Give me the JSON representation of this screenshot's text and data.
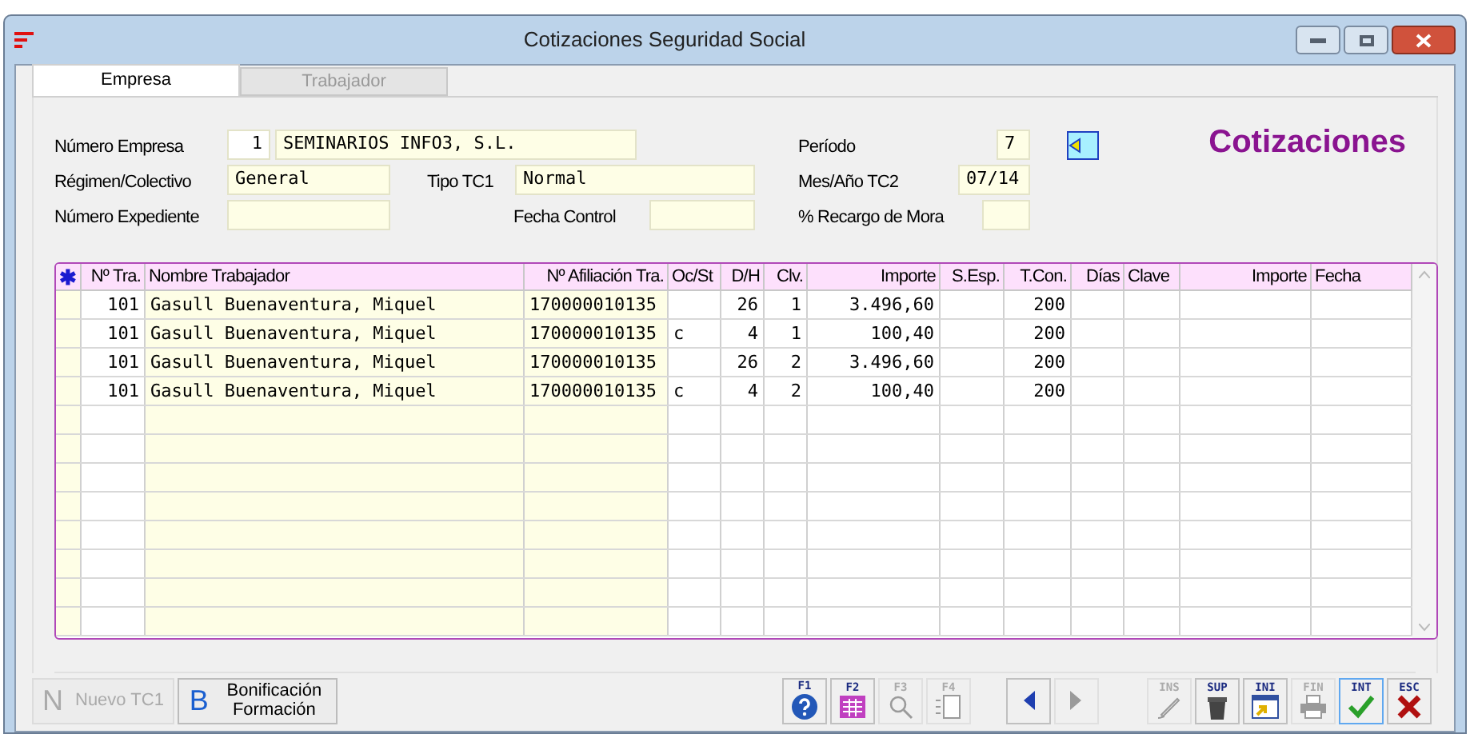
{
  "window": {
    "title": "Cotizaciones Seguridad Social"
  },
  "tabs": [
    {
      "label": "Empresa",
      "selected": true
    },
    {
      "label": "Trabajador",
      "selected": false
    }
  ],
  "form": {
    "numero_empresa": {
      "label": "Número Empresa",
      "code": "1",
      "name": "SEMINARIOS INFO3, S.L."
    },
    "regimen": {
      "label": "Régimen/Colectivo",
      "value": "General"
    },
    "tipo_tc1": {
      "label": "Tipo TC1",
      "value": "Normal"
    },
    "numero_expediente": {
      "label": "Número Expediente"
    },
    "fecha_control": {
      "label": "Fecha Control"
    },
    "periodo": {
      "label": "Período",
      "value": "7"
    },
    "mes_ano_tc2": {
      "label": "Mes/Año TC2",
      "value": "07/14"
    },
    "recargo_mora": {
      "label": "% Recargo de Mora"
    },
    "heading": "Cotizaciones"
  },
  "table": {
    "marker": "✱",
    "columns": [
      "Nº Tra.",
      "Nombre Trabajador",
      "Nº Afiliación Tra.",
      "Oc/St",
      "D/H",
      "Clv.",
      "Importe",
      "S.Esp.",
      "T.Con.",
      "Días",
      "Clave",
      "Importe",
      "Fecha"
    ],
    "rows": [
      {
        "n_tra": "101",
        "nombre": "Gasull Buenaventura, Miquel",
        "afiliacion": "170000010135",
        "d_h": "26",
        "clv": "1",
        "importe": "3.496,60",
        "t_con": "200"
      },
      {
        "n_tra": "101",
        "nombre": "Gasull Buenaventura, Miquel",
        "afiliacion": "170000010135",
        "oc_st": "c",
        "d_h": "4",
        "clv": "1",
        "importe": "100,40",
        "t_con": "200"
      },
      {
        "n_tra": "101",
        "nombre": "Gasull Buenaventura, Miquel",
        "afiliacion": "170000010135",
        "d_h": "26",
        "clv": "2",
        "importe": "3.496,60",
        "t_con": "200"
      },
      {
        "n_tra": "101",
        "nombre": "Gasull Buenaventura, Miquel",
        "afiliacion": "170000010135",
        "oc_st": "c",
        "d_h": "4",
        "clv": "2",
        "importe": "100,40",
        "t_con": "200"
      }
    ]
  },
  "actions": [
    {
      "letter": "N",
      "label": "Nuevo TC1",
      "disabled": true
    },
    {
      "letter": "B",
      "label": "Bonificación Formación",
      "disabled": false
    }
  ],
  "toolbar": [
    {
      "key": "F1",
      "kind": "help",
      "disabled": false
    },
    {
      "key": "F2",
      "kind": "table",
      "disabled": false
    },
    {
      "key": "F3",
      "kind": "search",
      "disabled": true
    },
    {
      "key": "F4",
      "kind": "list",
      "disabled": true
    },
    {
      "kind": "prev",
      "disabled": false
    },
    {
      "kind": "next",
      "disabled": true
    },
    {
      "key": "INS",
      "kind": "pencil",
      "disabled": true
    },
    {
      "key": "SUP",
      "kind": "trash",
      "disabled": false
    },
    {
      "key": "INI",
      "kind": "first",
      "disabled": false
    },
    {
      "key": "FIN",
      "kind": "printer",
      "disabled": true
    },
    {
      "key": "INT",
      "kind": "check",
      "disabled": false,
      "selected": true
    },
    {
      "key": "ESC",
      "kind": "close",
      "disabled": false,
      "selected": false
    }
  ]
}
